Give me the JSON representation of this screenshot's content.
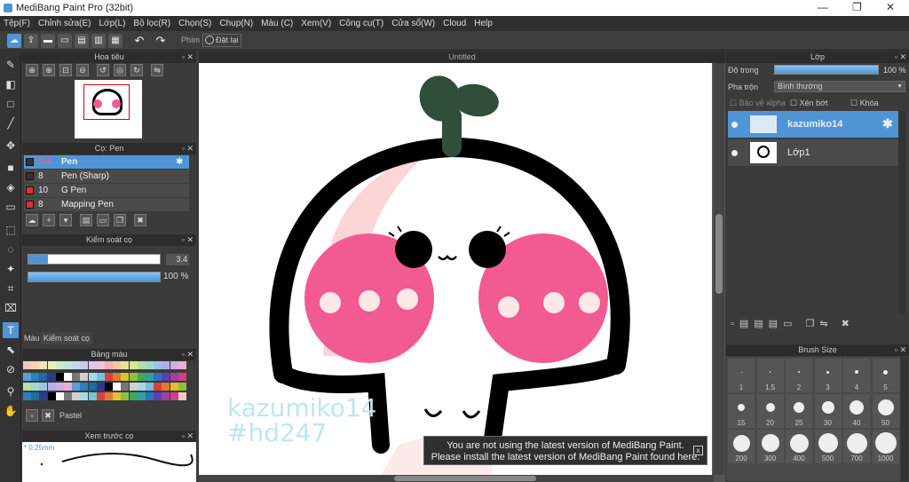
{
  "app": {
    "title": "MediBang Paint Pro (32bit)"
  },
  "menu": [
    "Tệp(F)",
    "Chỉnh sửa(E)",
    "Lớp(L)",
    "Bộ lọc(R)",
    "Chọn(S)",
    "Chụp(N)",
    "Màu (C)",
    "Xem(V)",
    "Công cụ(T)",
    "Cửa sổ(W)",
    "Cloud",
    "Help"
  ],
  "toolbar": {
    "key_label": "Phím",
    "reset_label": "Đặt lại"
  },
  "navigator": {
    "title": "Hoa tiêu"
  },
  "brush_panel": {
    "title": "Cọ: Pen",
    "items": [
      {
        "size": "3.4",
        "name": "Pen",
        "color": "#333333"
      },
      {
        "size": "8",
        "name": "Pen (Sharp)",
        "color": "#333333"
      },
      {
        "size": "10",
        "name": "G Pen",
        "color": "#e03030"
      },
      {
        "size": "8",
        "name": "Mapping Pen",
        "color": "#e03030"
      }
    ]
  },
  "brush_control": {
    "title": "Kiểm soát cọ",
    "size_value": "3.4",
    "opacity_value": "100 %",
    "size_fraction": 0.15,
    "opacity_fraction": 1.0
  },
  "color_tabs": {
    "color": "Màu",
    "brush_control": "Kiểm soát cọ"
  },
  "palette": {
    "title": "Bảng màu",
    "name": "Pastel"
  },
  "preview": {
    "title": "Xem trước cọ",
    "size": "* 0.25mm"
  },
  "canvas": {
    "title": "Untitled",
    "watermark_1": "kazumiko14",
    "watermark_2": "#hd247"
  },
  "notice": {
    "line1": "You are not using the latest version of MediBang Paint.",
    "line2": "Please install the latest version of MediBang Paint found here.",
    "close": "x"
  },
  "layer_panel": {
    "title": "Lớp",
    "opacity_label": "Độ trong",
    "opacity_value": "100 %",
    "blend_label": "Pha trộn",
    "blend_value": "Bình thường",
    "protect_alpha": "Bảo vệ alpha",
    "clipping": "Xén bớt",
    "lock": "Khóa",
    "layers": [
      {
        "name": "kazumiko14",
        "selected": true
      },
      {
        "name": "Lớp1",
        "selected": false
      }
    ]
  },
  "brush_size": {
    "title": "Brush Size",
    "sizes": [
      "1",
      "1.5",
      "2",
      "3",
      "4",
      "5",
      "15",
      "20",
      "25",
      "30",
      "40",
      "50",
      "200",
      "300",
      "400",
      "500",
      "700",
      "1000"
    ]
  },
  "colors": {
    "accent": "#4f95d6",
    "pink": "#f25a92",
    "sprout": "#2f4f3a"
  }
}
